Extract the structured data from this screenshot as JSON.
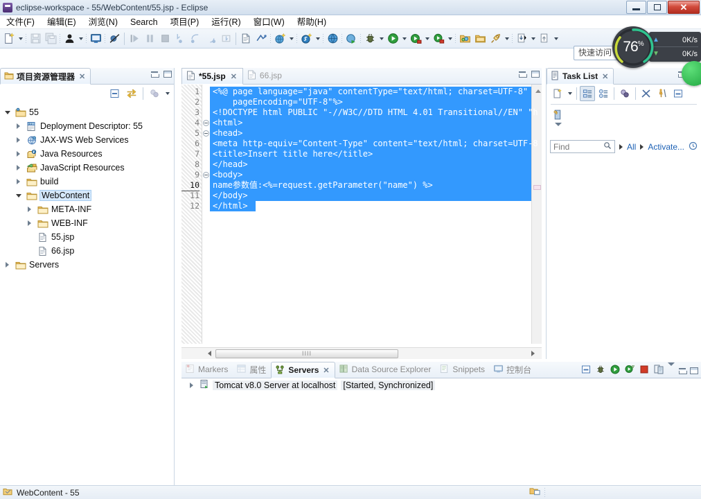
{
  "window": {
    "title": "eclipse-workspace - 55/WebContent/55.jsp - Eclipse",
    "icon": "eclipse-icon",
    "minimize_label": "",
    "maximize_label": "",
    "close_label": "✕"
  },
  "menubar": {
    "items": [
      {
        "label": "文件(F)",
        "name": "menu-file"
      },
      {
        "label": "编辑(E)",
        "name": "menu-edit"
      },
      {
        "label": "浏览(N)",
        "name": "menu-navigate"
      },
      {
        "label": "Search",
        "name": "menu-search"
      },
      {
        "label": "项目(P)",
        "name": "menu-project"
      },
      {
        "label": "运行(R)",
        "name": "menu-run"
      },
      {
        "label": "窗口(W)",
        "name": "menu-window"
      },
      {
        "label": "帮助(H)",
        "name": "menu-help"
      }
    ]
  },
  "toolbar": {
    "quick_access_placeholder": "快速访问",
    "items": [
      {
        "name": "new-wizard-icon",
        "kind": "new"
      },
      {
        "name": "new-dropdown-arrow",
        "kind": "arrow"
      },
      {
        "name": "separator-dots",
        "kind": "dots"
      },
      {
        "name": "save-icon",
        "kind": "save",
        "dim": true
      },
      {
        "name": "save-all-icon",
        "kind": "saveall",
        "dim": true
      },
      {
        "name": "separator-dots",
        "kind": "dots"
      },
      {
        "name": "user-icon",
        "kind": "user"
      },
      {
        "name": "user-dropdown-arrow",
        "kind": "arrow"
      },
      {
        "name": "separator-dots",
        "kind": "dots"
      },
      {
        "name": "open-console-icon",
        "kind": "console"
      },
      {
        "name": "separator-dots",
        "kind": "dots"
      },
      {
        "name": "skip-breakpoints-icon",
        "kind": "skipbp"
      },
      {
        "name": "separator-line",
        "kind": "sep"
      },
      {
        "name": "resume-icon",
        "kind": "resume",
        "dim": true
      },
      {
        "name": "suspend-icon",
        "kind": "suspend",
        "dim": true
      },
      {
        "name": "terminate-icon",
        "kind": "terminate",
        "dim": true
      },
      {
        "name": "step-into-icon",
        "kind": "stepinto",
        "dim": true
      },
      {
        "name": "step-over-icon",
        "kind": "stepover",
        "dim": true
      },
      {
        "name": "step-return-icon",
        "kind": "stepreturn",
        "dim": true
      },
      {
        "name": "drop-to-frame-icon",
        "kind": "dropframe",
        "dim": true
      },
      {
        "name": "separator-line",
        "kind": "sep"
      },
      {
        "name": "new-jsp-file-icon",
        "kind": "jspfile"
      },
      {
        "name": "new-servlet-icon",
        "kind": "servlet"
      },
      {
        "name": "separator-dots",
        "kind": "dots"
      },
      {
        "name": "new-web-project-icon",
        "kind": "webproj"
      },
      {
        "name": "webproj-dropdown-arrow",
        "kind": "arrow"
      },
      {
        "name": "separator-dots",
        "kind": "dots"
      },
      {
        "name": "new-java-class-icon",
        "kind": "javaclass"
      },
      {
        "name": "javaclass-dropdown-arrow",
        "kind": "arrow"
      },
      {
        "name": "separator-dots",
        "kind": "dots"
      },
      {
        "name": "open-browser-icon",
        "kind": "globe"
      },
      {
        "name": "separator-dots",
        "kind": "dots"
      },
      {
        "name": "run-on-server-icon",
        "kind": "runserver"
      },
      {
        "name": "separator-dots",
        "kind": "dots"
      },
      {
        "name": "debug-icon",
        "kind": "bug"
      },
      {
        "name": "debug-dropdown-arrow",
        "kind": "arrow"
      },
      {
        "name": "run-icon",
        "kind": "run"
      },
      {
        "name": "run-dropdown-arrow",
        "kind": "arrow"
      },
      {
        "name": "run-external-icon",
        "kind": "runext"
      },
      {
        "name": "runext-dropdown-arrow",
        "kind": "arrow"
      },
      {
        "name": "profile-icon",
        "kind": "profile"
      },
      {
        "name": "profile-dropdown-arrow",
        "kind": "arrow"
      },
      {
        "name": "separator-dots",
        "kind": "dots"
      },
      {
        "name": "open-type-icon",
        "kind": "opentype"
      },
      {
        "name": "open-task-icon",
        "kind": "opentask"
      },
      {
        "name": "search-rocket-icon",
        "kind": "rocket"
      },
      {
        "name": "rocket-dropdown-arrow",
        "kind": "arrow"
      },
      {
        "name": "separator-dots",
        "kind": "dots"
      },
      {
        "name": "next-annotation-icon",
        "kind": "nextann"
      },
      {
        "name": "nextann-dropdown-arrow",
        "kind": "arrow"
      },
      {
        "name": "previous-annotation-icon",
        "kind": "prevann"
      },
      {
        "name": "prevann-dropdown-arrow",
        "kind": "arrow"
      }
    ]
  },
  "cpu_widget": {
    "percent": "76",
    "percent_unit": "%",
    "upload_speed": "0K/s",
    "download_speed": "0K/s",
    "ring_color": "#2fc48f",
    "ring_color_2": "#c8d93a",
    "background": "#3c4047"
  },
  "project_explorer": {
    "tab_label": "项目资源管理器",
    "tab_icon": "project-explorer-icon",
    "close_label": "✕",
    "toolbar": [
      {
        "name": "collapse-all-icon"
      },
      {
        "name": "link-with-editor-icon"
      },
      {
        "name": "view-menu-filters-icon"
      },
      {
        "name": "view-menu-icon"
      }
    ],
    "tree": [
      {
        "label": "55",
        "icon": "project-icon",
        "indent": 0,
        "state": "open",
        "name": "tree-item-project-55"
      },
      {
        "label": "Deployment Descriptor: 55",
        "icon": "deployment-descriptor-icon",
        "indent": 1,
        "state": "closed",
        "name": "tree-item-deployment-descriptor"
      },
      {
        "label": "JAX-WS Web Services",
        "icon": "jaxws-icon",
        "indent": 1,
        "state": "closed",
        "name": "tree-item-jaxws"
      },
      {
        "label": "Java Resources",
        "icon": "java-resources-icon",
        "indent": 1,
        "state": "closed",
        "name": "tree-item-java-resources"
      },
      {
        "label": "JavaScript Resources",
        "icon": "javascript-resources-icon",
        "indent": 1,
        "state": "closed",
        "name": "tree-item-javascript-resources"
      },
      {
        "label": "build",
        "icon": "folder-icon",
        "indent": 1,
        "state": "closed",
        "name": "tree-item-build"
      },
      {
        "label": "WebContent",
        "icon": "folder-icon",
        "indent": 1,
        "state": "open",
        "selected": true,
        "name": "tree-item-webcontent"
      },
      {
        "label": "META-INF",
        "icon": "folder-icon",
        "indent": 2,
        "state": "closed",
        "name": "tree-item-meta-inf"
      },
      {
        "label": "WEB-INF",
        "icon": "folder-icon",
        "indent": 2,
        "state": "closed",
        "name": "tree-item-web-inf"
      },
      {
        "label": "55.jsp",
        "icon": "jsp-file-icon",
        "indent": 2,
        "state": "leaf",
        "name": "tree-item-55-jsp"
      },
      {
        "label": "66.jsp",
        "icon": "jsp-file-icon",
        "indent": 2,
        "state": "leaf",
        "name": "tree-item-66-jsp"
      },
      {
        "label": "Servers",
        "icon": "folder-icon",
        "indent": 0,
        "state": "closed",
        "name": "tree-item-servers"
      }
    ]
  },
  "editor": {
    "tabs": [
      {
        "label": "*55.jsp",
        "active": true,
        "icon": "jsp-file-icon",
        "close_label": "✕",
        "name": "editor-tab-55-jsp"
      },
      {
        "label": "66.jsp",
        "active": false,
        "icon": "jsp-file-icon",
        "name": "editor-tab-66-jsp"
      }
    ],
    "lines": [
      {
        "num": "1",
        "text": "<%@ page language=\"java\" contentType=\"text/html; charset=UTF-8\"",
        "fold": false
      },
      {
        "num": "2",
        "text": "    pageEncoding=\"UTF-8\"%>",
        "fold": false
      },
      {
        "num": "3",
        "text": "<!DOCTYPE html PUBLIC \"-//W3C//DTD HTML 4.01 Transitional//EN\" \"h",
        "fold": false
      },
      {
        "num": "4",
        "text": "<html>",
        "fold": true
      },
      {
        "num": "5",
        "text": "<head>",
        "fold": true
      },
      {
        "num": "6",
        "text": "<meta http-equiv=\"Content-Type\" content=\"text/html; charset=UTF-8",
        "fold": false
      },
      {
        "num": "7",
        "text": "<title>Insert title here</title>",
        "fold": false
      },
      {
        "num": "8",
        "text": "</head>",
        "fold": false
      },
      {
        "num": "9",
        "text": "<body>",
        "fold": true
      },
      {
        "num": "10",
        "text": "name参数值:<%=request.getParameter(\"name\") %>",
        "fold": false,
        "current": true
      },
      {
        "num": "11",
        "text": "</body>",
        "fold": false
      },
      {
        "num": "12",
        "text": "</html>",
        "fold": false
      }
    ],
    "selection_color": "#3399fe",
    "hscroll_thumb_glyph": "IIII"
  },
  "task_list": {
    "tab_label": "Task List",
    "tab_icon": "task-list-icon",
    "close_label": "✕",
    "toolbar": [
      {
        "name": "new-task-icon"
      },
      {
        "name": "new-task-dropdown-arrow"
      },
      {
        "name": "categorized-presentation-icon"
      },
      {
        "name": "scheduled-presentation-icon"
      },
      {
        "name": "synchronize-changed-icon"
      },
      {
        "name": "focus-on-workweek-icon"
      },
      {
        "name": "show-ui-legend-icon"
      },
      {
        "name": "collapse-all-icon"
      }
    ],
    "category_icon": "uncategorized-icon",
    "find_placeholder": "Find",
    "search_icon": "search-icon",
    "filter_all": "All",
    "filter_activate": "Activate...",
    "panel_min": "",
    "panel_max": ""
  },
  "bottom_panel": {
    "tabs": [
      {
        "label": "Markers",
        "icon": "markers-icon",
        "active": false,
        "name": "tab-markers"
      },
      {
        "label": "属性",
        "icon": "properties-icon",
        "active": false,
        "name": "tab-properties"
      },
      {
        "label": "Servers",
        "icon": "servers-icon",
        "active": true,
        "close_label": "✕",
        "name": "tab-servers"
      },
      {
        "label": "Data Source Explorer",
        "icon": "data-source-explorer-icon",
        "active": false,
        "name": "tab-data-source-explorer"
      },
      {
        "label": "Snippets",
        "icon": "snippets-icon",
        "active": false,
        "name": "tab-snippets"
      },
      {
        "label": "控制台",
        "icon": "console-icon",
        "active": false,
        "name": "tab-console"
      }
    ],
    "toolbar": [
      {
        "name": "collapse-all-icon"
      },
      {
        "name": "debug-server-icon"
      },
      {
        "name": "start-server-icon"
      },
      {
        "name": "profile-server-icon"
      },
      {
        "name": "stop-server-icon"
      },
      {
        "name": "publish-server-icon"
      },
      {
        "name": "view-menu-icon"
      },
      {
        "name": "minimize-icon"
      },
      {
        "name": "maximize-icon"
      }
    ],
    "server": {
      "name": "Tomcat v8.0 Server at localhost",
      "status": "[Started, Synchronized]",
      "icon": "server-icon",
      "expand_state": "closed"
    }
  },
  "statusbar": {
    "icon": "folder-selected-icon",
    "text": "WebContent - 55",
    "right_icon": "editor-state-icon"
  }
}
